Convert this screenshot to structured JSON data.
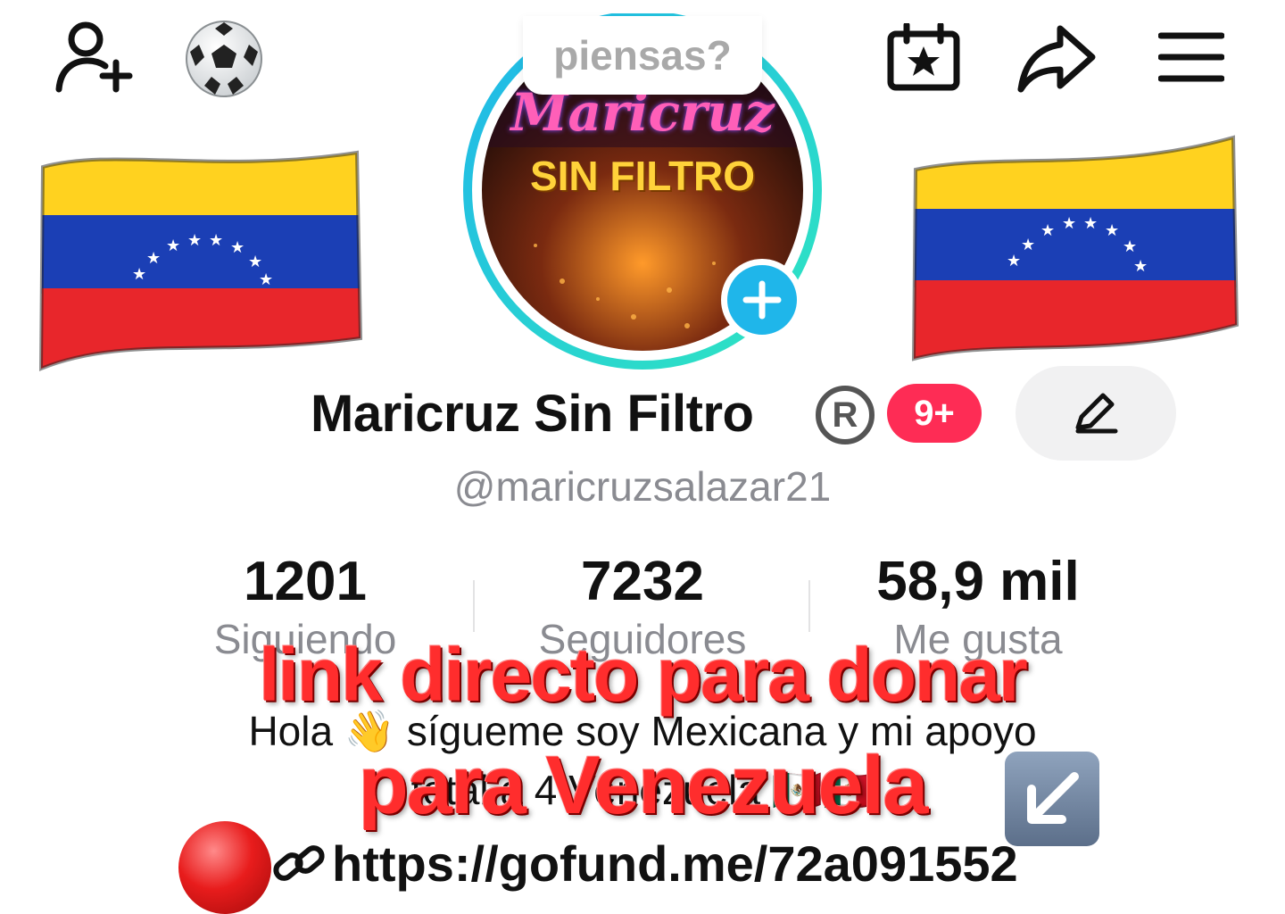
{
  "header": {
    "add_friend_icon": "person-add-icon",
    "soccer_emoji": "soccer-ball-icon",
    "calendar_icon": "calendar-star-icon",
    "share_icon": "share-arrow-icon",
    "menu_icon": "hamburger-menu-icon"
  },
  "avatar": {
    "bubble_text": "piensas?",
    "image_text_line1": "Maricruz",
    "image_text_line2": "SIN FILTRO",
    "add_icon": "plus-icon"
  },
  "profile": {
    "name": "Maricruz Sin Filtro",
    "registered_mark": "R",
    "notification_count": "9+",
    "handle": "@maricruzsalazar21"
  },
  "stats": [
    {
      "value": "1201",
      "label": "Siguiendo"
    },
    {
      "value": "7232",
      "label": "Seguidores"
    },
    {
      "value": "58,9 mil",
      "label": "Me gusta"
    }
  ],
  "bio": {
    "line1": "Hola 👋 sígueme soy Mexicana y mi apoyo",
    "line2": "total a 4 Venezuela 🇲🇽🇲🇽",
    "link": "https://gofund.me/72a091552",
    "arrow_emoji": "↙️"
  },
  "overlay": {
    "line1": "link  directo para donar",
    "line2": "para Venezuela"
  },
  "colors": {
    "accent_cyan": "#1fb6ea",
    "badge_red": "#fe2c55",
    "overlay_red": "#ff2d2d",
    "flag_yellow": "#ffd21f",
    "flag_blue": "#1b3fb5",
    "flag_red": "#e8262b"
  }
}
